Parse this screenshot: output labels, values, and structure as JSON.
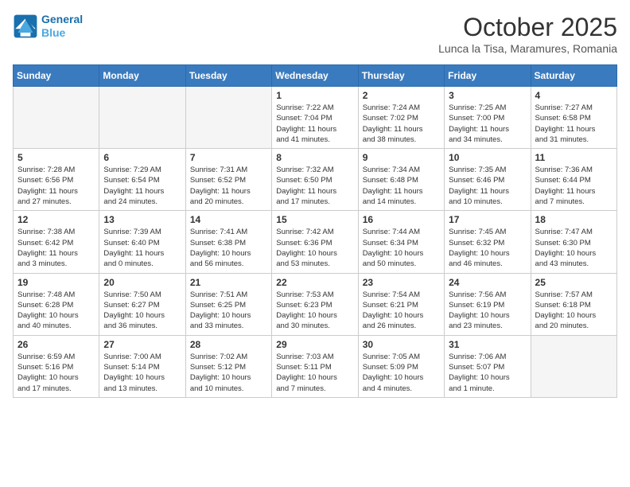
{
  "header": {
    "logo_line1": "General",
    "logo_line2": "Blue",
    "month": "October 2025",
    "location": "Lunca la Tisa, Maramures, Romania"
  },
  "weekdays": [
    "Sunday",
    "Monday",
    "Tuesday",
    "Wednesday",
    "Thursday",
    "Friday",
    "Saturday"
  ],
  "weeks": [
    [
      {
        "day": "",
        "info": ""
      },
      {
        "day": "",
        "info": ""
      },
      {
        "day": "",
        "info": ""
      },
      {
        "day": "1",
        "info": "Sunrise: 7:22 AM\nSunset: 7:04 PM\nDaylight: 11 hours\nand 41 minutes."
      },
      {
        "day": "2",
        "info": "Sunrise: 7:24 AM\nSunset: 7:02 PM\nDaylight: 11 hours\nand 38 minutes."
      },
      {
        "day": "3",
        "info": "Sunrise: 7:25 AM\nSunset: 7:00 PM\nDaylight: 11 hours\nand 34 minutes."
      },
      {
        "day": "4",
        "info": "Sunrise: 7:27 AM\nSunset: 6:58 PM\nDaylight: 11 hours\nand 31 minutes."
      }
    ],
    [
      {
        "day": "5",
        "info": "Sunrise: 7:28 AM\nSunset: 6:56 PM\nDaylight: 11 hours\nand 27 minutes."
      },
      {
        "day": "6",
        "info": "Sunrise: 7:29 AM\nSunset: 6:54 PM\nDaylight: 11 hours\nand 24 minutes."
      },
      {
        "day": "7",
        "info": "Sunrise: 7:31 AM\nSunset: 6:52 PM\nDaylight: 11 hours\nand 20 minutes."
      },
      {
        "day": "8",
        "info": "Sunrise: 7:32 AM\nSunset: 6:50 PM\nDaylight: 11 hours\nand 17 minutes."
      },
      {
        "day": "9",
        "info": "Sunrise: 7:34 AM\nSunset: 6:48 PM\nDaylight: 11 hours\nand 14 minutes."
      },
      {
        "day": "10",
        "info": "Sunrise: 7:35 AM\nSunset: 6:46 PM\nDaylight: 11 hours\nand 10 minutes."
      },
      {
        "day": "11",
        "info": "Sunrise: 7:36 AM\nSunset: 6:44 PM\nDaylight: 11 hours\nand 7 minutes."
      }
    ],
    [
      {
        "day": "12",
        "info": "Sunrise: 7:38 AM\nSunset: 6:42 PM\nDaylight: 11 hours\nand 3 minutes."
      },
      {
        "day": "13",
        "info": "Sunrise: 7:39 AM\nSunset: 6:40 PM\nDaylight: 11 hours\nand 0 minutes."
      },
      {
        "day": "14",
        "info": "Sunrise: 7:41 AM\nSunset: 6:38 PM\nDaylight: 10 hours\nand 56 minutes."
      },
      {
        "day": "15",
        "info": "Sunrise: 7:42 AM\nSunset: 6:36 PM\nDaylight: 10 hours\nand 53 minutes."
      },
      {
        "day": "16",
        "info": "Sunrise: 7:44 AM\nSunset: 6:34 PM\nDaylight: 10 hours\nand 50 minutes."
      },
      {
        "day": "17",
        "info": "Sunrise: 7:45 AM\nSunset: 6:32 PM\nDaylight: 10 hours\nand 46 minutes."
      },
      {
        "day": "18",
        "info": "Sunrise: 7:47 AM\nSunset: 6:30 PM\nDaylight: 10 hours\nand 43 minutes."
      }
    ],
    [
      {
        "day": "19",
        "info": "Sunrise: 7:48 AM\nSunset: 6:28 PM\nDaylight: 10 hours\nand 40 minutes."
      },
      {
        "day": "20",
        "info": "Sunrise: 7:50 AM\nSunset: 6:27 PM\nDaylight: 10 hours\nand 36 minutes."
      },
      {
        "day": "21",
        "info": "Sunrise: 7:51 AM\nSunset: 6:25 PM\nDaylight: 10 hours\nand 33 minutes."
      },
      {
        "day": "22",
        "info": "Sunrise: 7:53 AM\nSunset: 6:23 PM\nDaylight: 10 hours\nand 30 minutes."
      },
      {
        "day": "23",
        "info": "Sunrise: 7:54 AM\nSunset: 6:21 PM\nDaylight: 10 hours\nand 26 minutes."
      },
      {
        "day": "24",
        "info": "Sunrise: 7:56 AM\nSunset: 6:19 PM\nDaylight: 10 hours\nand 23 minutes."
      },
      {
        "day": "25",
        "info": "Sunrise: 7:57 AM\nSunset: 6:18 PM\nDaylight: 10 hours\nand 20 minutes."
      }
    ],
    [
      {
        "day": "26",
        "info": "Sunrise: 6:59 AM\nSunset: 5:16 PM\nDaylight: 10 hours\nand 17 minutes."
      },
      {
        "day": "27",
        "info": "Sunrise: 7:00 AM\nSunset: 5:14 PM\nDaylight: 10 hours\nand 13 minutes."
      },
      {
        "day": "28",
        "info": "Sunrise: 7:02 AM\nSunset: 5:12 PM\nDaylight: 10 hours\nand 10 minutes."
      },
      {
        "day": "29",
        "info": "Sunrise: 7:03 AM\nSunset: 5:11 PM\nDaylight: 10 hours\nand 7 minutes."
      },
      {
        "day": "30",
        "info": "Sunrise: 7:05 AM\nSunset: 5:09 PM\nDaylight: 10 hours\nand 4 minutes."
      },
      {
        "day": "31",
        "info": "Sunrise: 7:06 AM\nSunset: 5:07 PM\nDaylight: 10 hours\nand 1 minute."
      },
      {
        "day": "",
        "info": ""
      }
    ]
  ]
}
